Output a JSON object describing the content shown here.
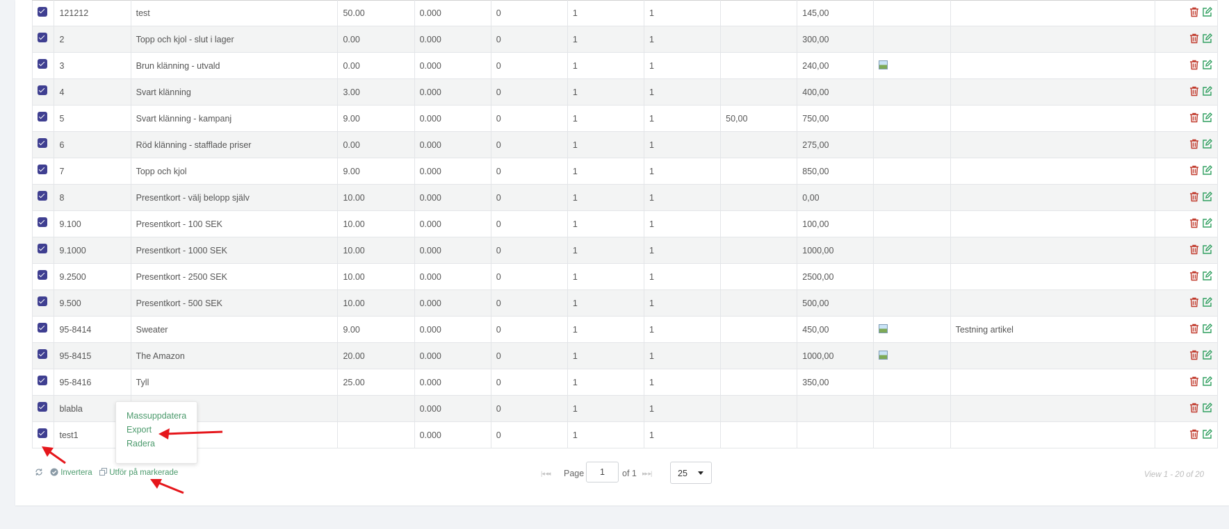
{
  "columns_hint": [
    "select",
    "id",
    "name",
    "col3",
    "col4",
    "col5",
    "col6",
    "col7",
    "col8",
    "price",
    "image",
    "note",
    "actions"
  ],
  "rows": [
    {
      "id": "121212",
      "name": "test",
      "c3": "50.00",
      "c4": "0.000",
      "c5": "0",
      "c6": "1",
      "c7": "1",
      "c8": "",
      "price": "145,00",
      "img": false,
      "note": ""
    },
    {
      "id": "2",
      "name": "Topp och kjol - slut i lager",
      "c3": "0.00",
      "c4": "0.000",
      "c5": "0",
      "c6": "1",
      "c7": "1",
      "c8": "",
      "price": "300,00",
      "img": false,
      "note": ""
    },
    {
      "id": "3",
      "name": "Brun klänning - utvald",
      "c3": "0.00",
      "c4": "0.000",
      "c5": "0",
      "c6": "1",
      "c7": "1",
      "c8": "",
      "price": "240,00",
      "img": true,
      "note": ""
    },
    {
      "id": "4",
      "name": "Svart klänning",
      "c3": "3.00",
      "c4": "0.000",
      "c5": "0",
      "c6": "1",
      "c7": "1",
      "c8": "",
      "price": "400,00",
      "img": false,
      "note": ""
    },
    {
      "id": "5",
      "name": "Svart klänning - kampanj",
      "c3": "9.00",
      "c4": "0.000",
      "c5": "0",
      "c6": "1",
      "c7": "1",
      "c8": "50,00",
      "price": "750,00",
      "img": false,
      "note": ""
    },
    {
      "id": "6",
      "name": "Röd klänning - stafflade priser",
      "c3": "0.00",
      "c4": "0.000",
      "c5": "0",
      "c6": "1",
      "c7": "1",
      "c8": "",
      "price": "275,00",
      "img": false,
      "note": ""
    },
    {
      "id": "7",
      "name": "Topp och kjol",
      "c3": "9.00",
      "c4": "0.000",
      "c5": "0",
      "c6": "1",
      "c7": "1",
      "c8": "",
      "price": "850,00",
      "img": false,
      "note": ""
    },
    {
      "id": "8",
      "name": "Presentkort - välj belopp själv",
      "c3": "10.00",
      "c4": "0.000",
      "c5": "0",
      "c6": "1",
      "c7": "1",
      "c8": "",
      "price": "0,00",
      "img": false,
      "note": ""
    },
    {
      "id": "9.100",
      "name": "Presentkort - 100 SEK",
      "c3": "10.00",
      "c4": "0.000",
      "c5": "0",
      "c6": "1",
      "c7": "1",
      "c8": "",
      "price": "100,00",
      "img": false,
      "note": ""
    },
    {
      "id": "9.1000",
      "name": "Presentkort - 1000 SEK",
      "c3": "10.00",
      "c4": "0.000",
      "c5": "0",
      "c6": "1",
      "c7": "1",
      "c8": "",
      "price": "1000,00",
      "img": false,
      "note": ""
    },
    {
      "id": "9.2500",
      "name": "Presentkort - 2500 SEK",
      "c3": "10.00",
      "c4": "0.000",
      "c5": "0",
      "c6": "1",
      "c7": "1",
      "c8": "",
      "price": "2500,00",
      "img": false,
      "note": ""
    },
    {
      "id": "9.500",
      "name": "Presentkort - 500 SEK",
      "c3": "10.00",
      "c4": "0.000",
      "c5": "0",
      "c6": "1",
      "c7": "1",
      "c8": "",
      "price": "500,00",
      "img": false,
      "note": ""
    },
    {
      "id": "95-8414",
      "name": "Sweater",
      "c3": "9.00",
      "c4": "0.000",
      "c5": "0",
      "c6": "1",
      "c7": "1",
      "c8": "",
      "price": "450,00",
      "img": true,
      "note": "Testning artikel"
    },
    {
      "id": "95-8415",
      "name": "The Amazon",
      "c3": "20.00",
      "c4": "0.000",
      "c5": "0",
      "c6": "1",
      "c7": "1",
      "c8": "",
      "price": "1000,00",
      "img": true,
      "note": ""
    },
    {
      "id": "95-8416",
      "name": "Tyll",
      "c3": "25.00",
      "c4": "0.000",
      "c5": "0",
      "c6": "1",
      "c7": "1",
      "c8": "",
      "price": "350,00",
      "img": false,
      "note": ""
    },
    {
      "id": "blabla",
      "name": "",
      "c3": "",
      "c4": "0.000",
      "c5": "0",
      "c6": "1",
      "c7": "1",
      "c8": "",
      "price": "",
      "img": false,
      "note": ""
    },
    {
      "id": "test1",
      "name": "",
      "c3": "",
      "c4": "0.000",
      "c5": "0",
      "c6": "1",
      "c7": "1",
      "c8": "",
      "price": "",
      "img": false,
      "note": ""
    }
  ],
  "popup_menu": {
    "items": [
      "Massuppdatera",
      "Export",
      "Radera"
    ]
  },
  "footer": {
    "refresh_icon": "refresh-icon",
    "invert_label": "Invertera",
    "apply_label": "Utför på markerade"
  },
  "pager": {
    "first_icon": "first-page-icon",
    "prev_icon": "prev-page-icon",
    "page_label": "Page",
    "page_value": "1",
    "of_label": "of 1",
    "next_icon": "next-page-icon",
    "last_icon": "last-page-icon",
    "rows_per_page": "25"
  },
  "view_info": "View 1 - 20 of 20",
  "colors": {
    "checkbox": "#3f3f91",
    "delete_icon": "#c0392b",
    "edit_icon": "#2e9e5e",
    "link": "#4b9a6c",
    "annotation_arrow": "#e5161b"
  }
}
